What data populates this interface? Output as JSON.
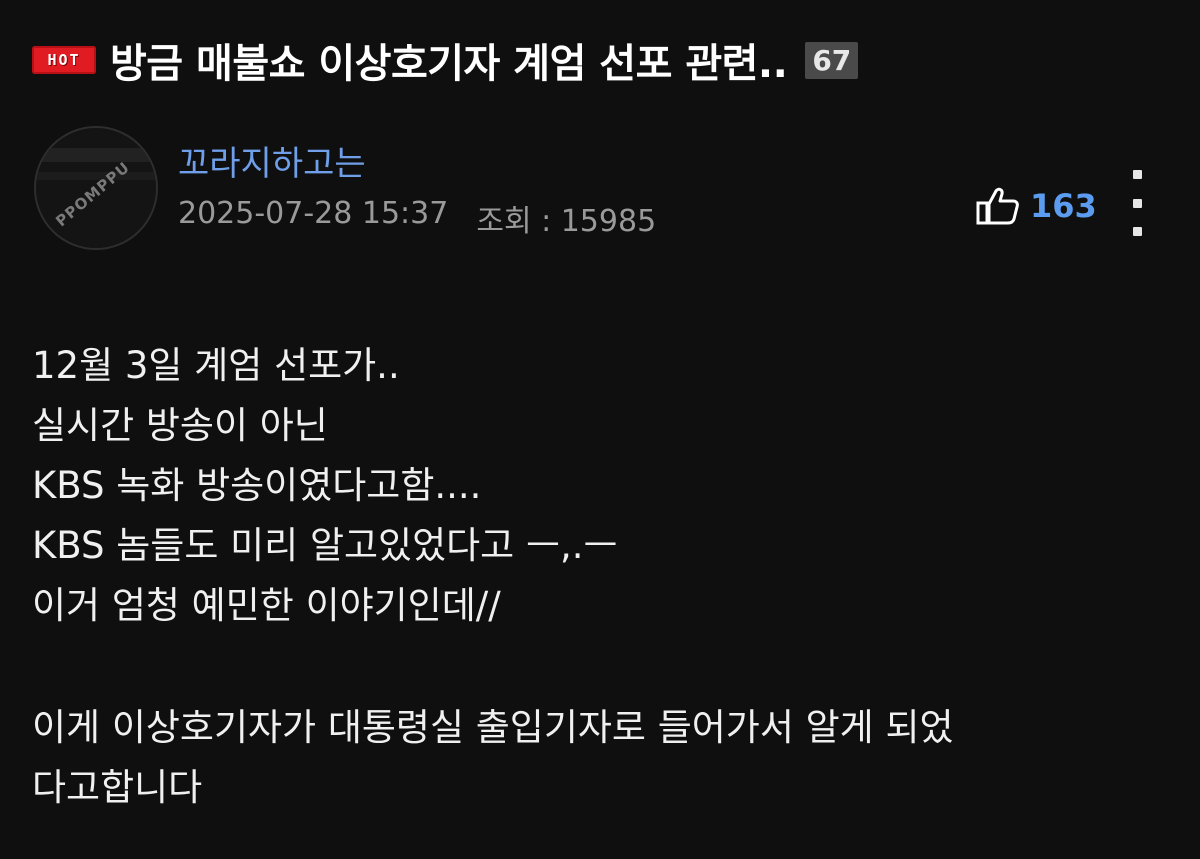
{
  "post": {
    "hot_label": "HOT",
    "title": "방금 매불쇼 이상호기자 계엄 선포 관련..",
    "comment_count": "67"
  },
  "author": {
    "name": "꼬라지하고는",
    "avatar_watermark": "PPOMPPU",
    "date": "2025-07-28 15:37",
    "views": "조회 : 15985"
  },
  "actions": {
    "like_count": "163",
    "like_icon": "thumbs-up-icon",
    "more_icon": "more-vertical-icon"
  },
  "content": {
    "paragraph1": [
      "12월 3일 계엄 선포가..",
      "실시간 방송이 아닌",
      "KBS 녹화 방송이였다고함....",
      "KBS 놈들도 미리 알고있었다고 ㅡ,.ㅡ",
      "이거 엄청 예민한 이야기인데//"
    ],
    "paragraph2": [
      "이게 이상호기자가 대통령실 출입기자로 들어가서 알게 되었",
      "다고합니다"
    ]
  },
  "colors": {
    "background": "#0f0f0f",
    "hot_badge": "#e11b22",
    "author_link": "#6f9fe8",
    "like_accent": "#5b9cf0"
  }
}
